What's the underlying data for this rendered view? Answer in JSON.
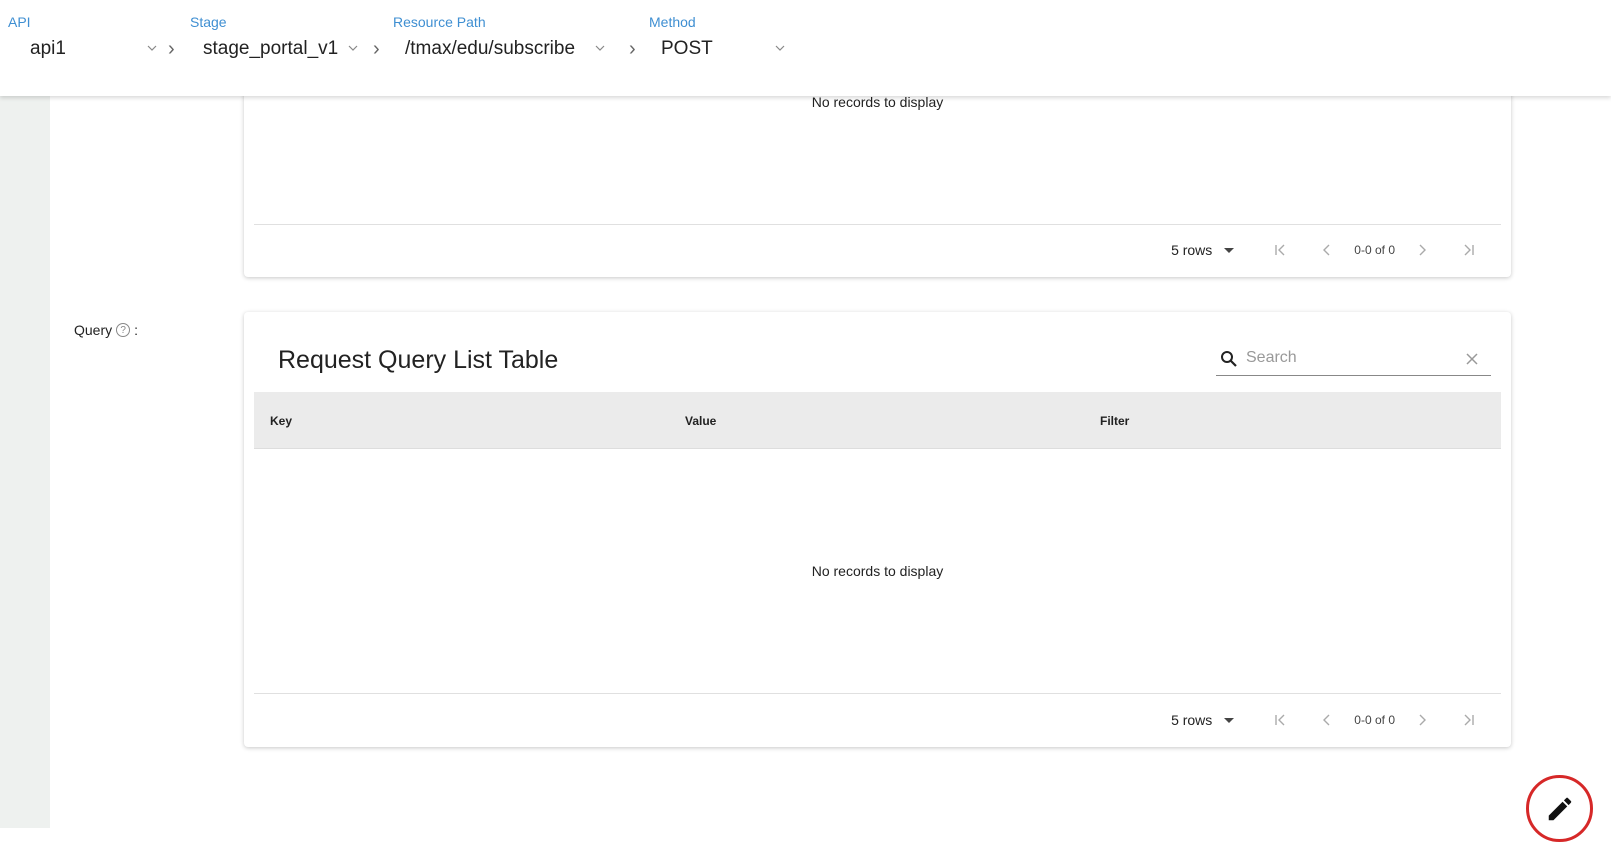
{
  "breadcrumb": {
    "api": {
      "label": "API",
      "value": "api1"
    },
    "stage": {
      "label": "Stage",
      "value": "stage_portal_v1"
    },
    "resource": {
      "label": "Resource Path",
      "value": "/tmax/edu/subscribe"
    },
    "method": {
      "label": "Method",
      "value": "POST"
    }
  },
  "top_table": {
    "empty_text": "No records to display",
    "rows_per_page": "5 rows",
    "range": "0-0 of 0"
  },
  "query_section": {
    "label": "Query",
    "help": "?",
    "suffix": ":",
    "table_title": "Request Query List Table",
    "search_placeholder": "Search",
    "columns": [
      "Key",
      "Value",
      "Filter"
    ],
    "empty_text": "No records to display",
    "rows_per_page": "5 rows",
    "range": "0-0 of 0"
  },
  "colors": {
    "accent": "#3f8fd2",
    "fab_border": "#d62828",
    "rail": "#eef1ef"
  },
  "icons": [
    "chevron-down-icon",
    "chevron-right-icon",
    "first-page-icon",
    "prev-page-icon",
    "next-page-icon",
    "last-page-icon",
    "search-icon",
    "clear-icon",
    "edit-icon",
    "help-icon"
  ]
}
